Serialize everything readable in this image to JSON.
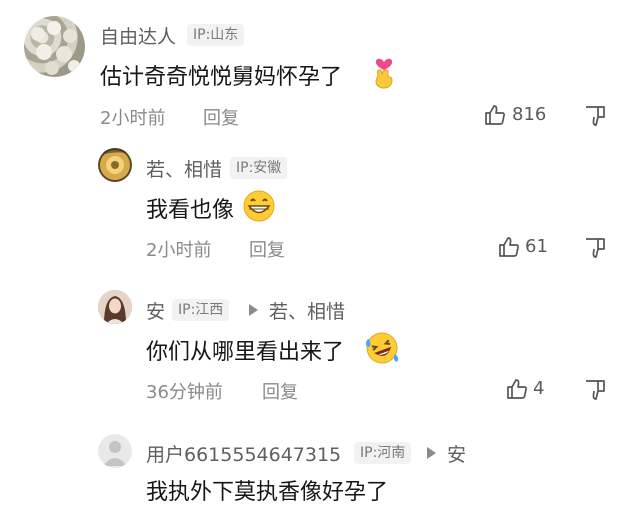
{
  "comments": [
    {
      "username": "自由达人",
      "ip": "IP:山东",
      "text": "估计奇奇悦悦舅妈怀孕了",
      "emoji_icon": "crossed-fingers-heart-emoji-icon",
      "time": "2小时前",
      "reply_label": "回复",
      "likes": "816"
    },
    {
      "username": "若、相惜",
      "ip": "IP:安徽",
      "text": "我看也像",
      "emoji_icon": "grinning-emoji-icon",
      "time": "2小时前",
      "reply_label": "回复",
      "likes": "61"
    },
    {
      "username": "安",
      "ip": "IP:江西",
      "reply_to": "若、相惜",
      "text": "你们从哪里看出来了",
      "emoji_icon": "laughing-tears-emoji-icon",
      "time": "36分钟前",
      "reply_label": "回复",
      "likes": "4"
    },
    {
      "username": "用户6615554647315",
      "ip": "IP:河南",
      "reply_to": "安",
      "text": "我执外下莫执香像好孕了"
    }
  ],
  "colors": {
    "name": "#5f5f5f",
    "meta": "#8a8a8a",
    "badge_bg": "#f2f2f2",
    "emoji_yellow": "#ffcc33"
  }
}
